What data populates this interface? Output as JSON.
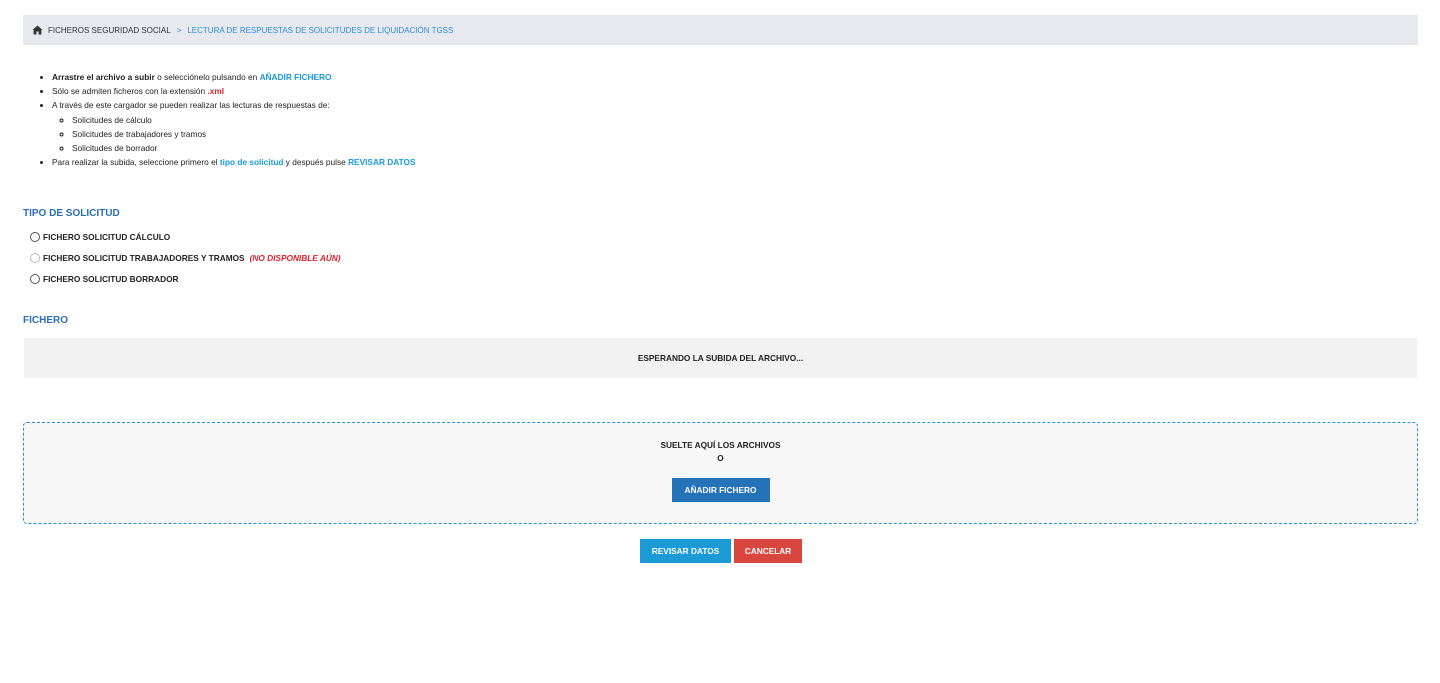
{
  "breadcrumb": {
    "root": "FICHEROS SEGURIDAD SOCIAL",
    "separator": ">",
    "current": "LECTURA DE RESPUESTAS DE SOLICITUDES DE LIQUIDACIÓN TGSS"
  },
  "instructions": {
    "line1_bold": "Arrastre el archivo a subir",
    "line1_text": " o selecciónelo pulsando en ",
    "line1_link": "AÑADIR FICHERO",
    "line2_text": "Sólo se admiten ficheros con la extensión ",
    "line2_ext": ".xml",
    "line3_text": "A través de este cargador se pueden realizar las lecturas de respuestas de:",
    "sub_items": [
      "Solicitudes de cálculo",
      "Solicitudes de trabajadores y tramos",
      "Solicitudes de borrador"
    ],
    "line4_text": "Para realizar la subida, seleccione primero el ",
    "line4_link1": "tipo de solicitud",
    "line4_mid": " y después pulse ",
    "line4_link2": "REVISAR DATOS"
  },
  "request_type": {
    "title": "TIPO DE SOLICITUD",
    "options": [
      {
        "label": "FICHERO SOLICITUD CÁLCULO",
        "disabled": false
      },
      {
        "label": "FICHERO SOLICITUD TRABAJADORES Y TRAMOS",
        "disabled": true,
        "note": "(NO DISPONIBLE AÚN)"
      },
      {
        "label": "FICHERO SOLICITUD BORRADOR",
        "disabled": false
      }
    ]
  },
  "file": {
    "title": "FICHERO",
    "status": "ESPERANDO LA SUBIDA DEL ARCHIVO..."
  },
  "dropzone": {
    "text": "SUELTE AQUÍ LOS ARCHIVOS",
    "or": "O",
    "add_button": "AÑADIR FICHERO"
  },
  "actions": {
    "review": "REVISAR DATOS",
    "cancel": "CANCELAR"
  },
  "colors": {
    "accent_blue": "#1b9ad6",
    "title_blue": "#2a6eb7",
    "danger_red": "#d9232e",
    "cancel_red": "#d9463f",
    "add_button_blue": "#2472b8"
  }
}
